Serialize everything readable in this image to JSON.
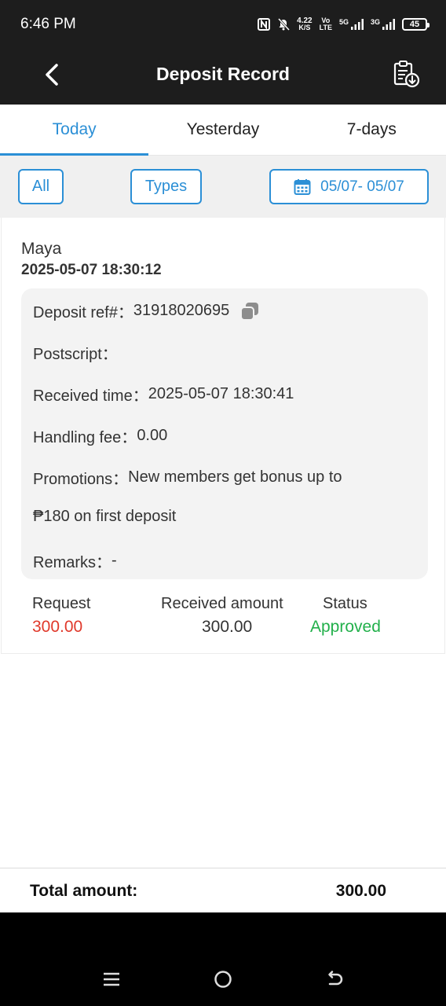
{
  "status_bar": {
    "time": "6:46 PM",
    "net_speed_value": "4.22",
    "net_speed_unit": "K/S",
    "volte_top": "Vo",
    "volte_bottom": "LTE",
    "sig1_label": "5G",
    "sig2_label": "3G",
    "battery": "45"
  },
  "header": {
    "title": "Deposit Record"
  },
  "tabs": [
    {
      "label": "Today",
      "active": true
    },
    {
      "label": "Yesterday",
      "active": false
    },
    {
      "label": "7-days",
      "active": false
    }
  ],
  "filters": {
    "all_label": "All",
    "types_label": "Types",
    "date_range": "05/07- 05/07"
  },
  "record": {
    "method": "Maya",
    "datetime": "2025-05-07 18:30:12",
    "deposit_ref_label": "Deposit ref#：",
    "deposit_ref": "31918020695",
    "postscript_label": "Postscript：",
    "postscript": "",
    "received_time_label": "Received time：",
    "received_time": "2025-05-07 18:30:41",
    "handling_fee_label": "Handling fee：",
    "handling_fee": "0.00",
    "promotions_label": "Promotions：",
    "promotions_line1": "New members get bonus up to",
    "promotions_line2": "₱180 on first deposit",
    "remarks_label": "Remarks：",
    "remarks": "-",
    "request_label": "Request",
    "request_value": "300.00",
    "received_amount_label": "Received amount",
    "received_amount_value": "300.00",
    "status_label": "Status",
    "status_value": "Approved"
  },
  "total": {
    "label": "Total amount:",
    "value": "300.00"
  },
  "colors": {
    "accent": "#2b8fd6",
    "request": "#e0392b",
    "approved": "#22b04b",
    "header_bg": "#1d1d1d"
  }
}
